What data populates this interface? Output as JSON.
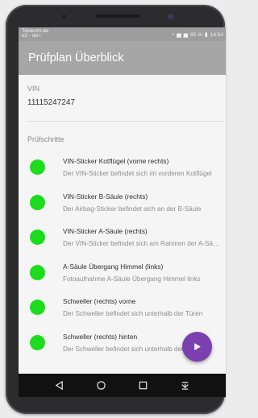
{
  "status_bar": {
    "carrier_line1": "Telekom.de",
    "carrier_line2": "o2 - de+",
    "battery": "85 %",
    "time": "14:54"
  },
  "app_bar": {
    "title": "Prüfplan Überblick"
  },
  "vin": {
    "label": "VIN",
    "value": "11115247247"
  },
  "steps_section": {
    "label": "Prüfschritte"
  },
  "steps": [
    {
      "title": "VIN-Sticker Kotflügel (vorne rechts)",
      "subtitle": "Der VIN-Sticker befindet sich im vorderen Kotflügel",
      "status_color": "#1cdc1c"
    },
    {
      "title": "VIN-Sticker B-Säule (rechts)",
      "subtitle": "Der Airbag-Sticker befindet sich an der B-Säule",
      "status_color": "#1cdc1c"
    },
    {
      "title": "VIN-Sticker A-Säule (rechts)",
      "subtitle": "Der VIN-Sticker befindet sich am Rahmen der A-Säule",
      "status_color": "#1cdc1c"
    },
    {
      "title": "A-Säule Übergang Himmel (links)",
      "subtitle": "Fotoaufnahme A-Säule Übergang Himmel links",
      "status_color": "#1cdc1c"
    },
    {
      "title": "Schweller (rechts) vorne",
      "subtitle": "Der Schweller befindet sich unterhalb der Türen",
      "status_color": "#1cdc1c"
    },
    {
      "title": "Schweller (rechts) hinten",
      "subtitle": "Der Schweller befindet sich unterhalb der Türen",
      "status_color": "#1cdc1c"
    }
  ],
  "fab": {
    "icon": "play-icon",
    "color": "#7b3fb0"
  },
  "nav_bar": {
    "icons": [
      "back-icon",
      "home-icon",
      "recents-icon",
      "notification-shade-icon"
    ]
  }
}
